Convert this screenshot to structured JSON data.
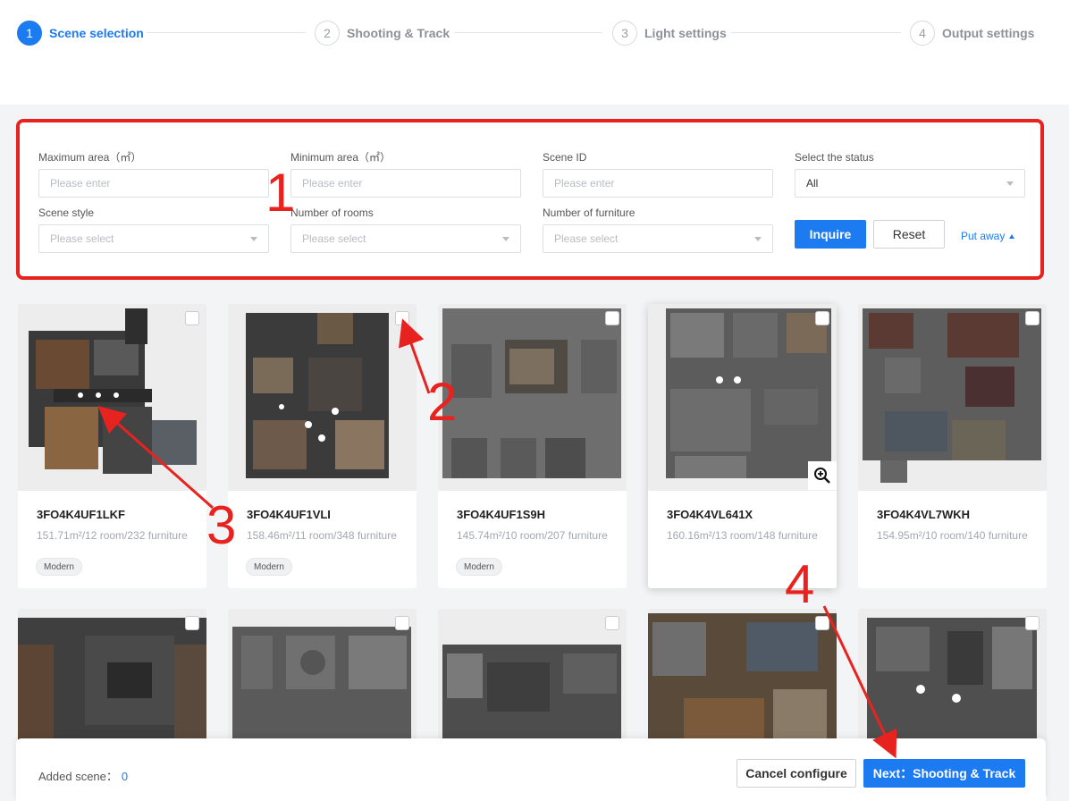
{
  "stepper": {
    "steps": [
      {
        "num": "1",
        "label": "Scene selection"
      },
      {
        "num": "2",
        "label": "Shooting & Track"
      },
      {
        "num": "3",
        "label": "Light settings"
      },
      {
        "num": "4",
        "label": "Output settings"
      }
    ],
    "active_index": 0
  },
  "filters": {
    "max_area": {
      "label": "Maximum area（㎡）",
      "placeholder": "Please enter"
    },
    "min_area": {
      "label": "Minimum area（㎡）",
      "placeholder": "Please enter"
    },
    "scene_id": {
      "label": "Scene ID",
      "placeholder": "Please enter"
    },
    "status": {
      "label": "Select the status",
      "value": "All"
    },
    "style": {
      "label": "Scene style",
      "placeholder": "Please select"
    },
    "rooms": {
      "label": "Number of rooms",
      "placeholder": "Please select"
    },
    "furniture": {
      "label": "Number of furniture",
      "placeholder": "Please select"
    },
    "inquire_label": "Inquire",
    "reset_label": "Reset",
    "put_away_label": "Put away"
  },
  "scenes": [
    {
      "id": "3FO4K4UF1LKF",
      "meta": "151.71m²/12 room/232 furniture",
      "tag": "Modern"
    },
    {
      "id": "3FO4K4UF1VLI",
      "meta": "158.46m²/11 room/348 furniture",
      "tag": "Modern"
    },
    {
      "id": "3FO4K4UF1S9H",
      "meta": "145.74m²/10 room/207 furniture",
      "tag": "Modern"
    },
    {
      "id": "3FO4K4VL641X",
      "meta": "160.16m²/13 room/148 furniture",
      "tag": ""
    },
    {
      "id": "3FO4K4VL7WKH",
      "meta": "154.95m²/10 room/140 furniture",
      "tag": ""
    }
  ],
  "bottom": {
    "added_label": "Added scene：",
    "added_count": "0",
    "cancel_label": "Cancel configure",
    "next_label": "Next：Shooting & Track"
  },
  "annotations": [
    "1",
    "2",
    "3",
    "4"
  ],
  "colors": {
    "accent": "#1d7bf2",
    "annotation": "#e8231f"
  }
}
